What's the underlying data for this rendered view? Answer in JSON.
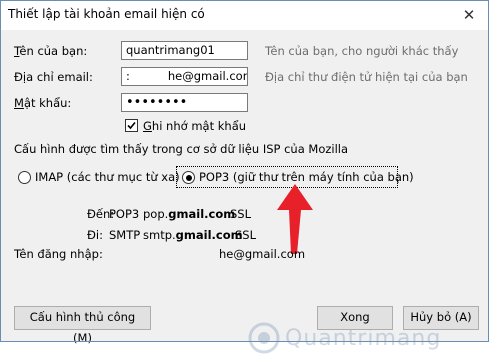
{
  "window": {
    "title": "Thiết lập tài khoản email hiện có",
    "close_glyph": "✕"
  },
  "form": {
    "name": {
      "label": "Tên của bạn:",
      "value": "quantrimang01",
      "hint": "Tên của bạn, cho người khác thấy"
    },
    "email": {
      "label": "Địa chỉ email:",
      "value_prefix": ":",
      "value_suffix": "he@gmail.com",
      "hint": "Địa chỉ thư điện tử hiện tại của bạn"
    },
    "password": {
      "label": "Mật khẩu:",
      "value": "••••••••"
    },
    "remember": {
      "label": "Ghi nhớ mật khẩu",
      "checked": true
    }
  },
  "config": {
    "message": "Cấu hình được tìm thấy trong cơ sở dữ liệu ISP của Mozilla",
    "imap_label": "IMAP (các thư mục từ xa)",
    "pop3_label": "POP3 (giữ thư trên máy tính của bạn)",
    "selected": "POP3"
  },
  "servers": {
    "incoming": {
      "label": "Đến:",
      "protocol": "POP3",
      "host_prefix": "pop.",
      "host_bold": "gmail.com",
      "security": "SSL"
    },
    "outgoing": {
      "label": "Đi:",
      "protocol": "SMTP",
      "host_prefix": "smtp.",
      "host_bold": "gmail.com",
      "security": "SSL"
    },
    "username": {
      "label": "Tên đăng nhập:",
      "value": "he@gmail.com"
    }
  },
  "buttons": {
    "manual": "Cấu hình thủ công (M)",
    "done": "Xong",
    "cancel": "Hủy bỏ (A)"
  },
  "watermark": {
    "text": "Quantrimang"
  },
  "colors": {
    "arrow": "#e8202a",
    "border": "#6b8db4"
  }
}
